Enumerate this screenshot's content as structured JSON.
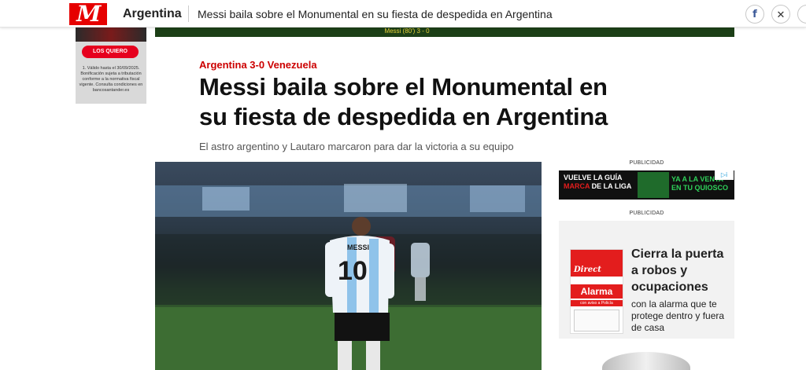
{
  "header": {
    "logo_letter": "M",
    "section": "Argentina",
    "title": "Messi baila sobre el Monumental en su fiesta de despedida en Argentina",
    "share": {
      "facebook_icon": "facebook-icon",
      "x_icon": "x-icon",
      "facebook_glyph": "f",
      "x_glyph": "✕"
    },
    "brand_color": "#e60000"
  },
  "left_ad": {
    "button_label": "LOS QUIERO",
    "legal_text": "1. Válido hasta el 30/09/2025. Bonificación sujeta a tributación conforme a la normativa fiscal vigente. Consulta condiciones en bancosantander.es"
  },
  "score_strip": {
    "text": "Messi (80') 3 - 0"
  },
  "article": {
    "kicker": "Argentina 3-0 Venezuela",
    "headline": "Messi baila sobre el Monumental en su fiesta de despedida en Argentina",
    "subtitle": "El astro argentino y Lautaro marcaron para dar la victoria a su equipo",
    "photo": {
      "jersey_number": "10",
      "jersey_name": "MESSI"
    }
  },
  "ads": {
    "publicidad_label_1": "PUBLICIDAD",
    "publicidad_label_2": "PUBLICIDAD",
    "banner_left_line1": "VUELVE LA GUÍA",
    "banner_left_line2a": "MARCA",
    "banner_left_line2b": " DE LA LIGA",
    "banner_right_line1": "YA A LA VENTA",
    "banner_right_line2": "EN TU QUIOSCO",
    "adchoices_glyph": "▷ⅰ",
    "alarm_brand": "Direct",
    "alarm_word": "Alarma",
    "alarm_sub": "con aviso a Policía",
    "alarm_headline": "Cierra la puerta a robos y ocupaciones",
    "alarm_body": "con la alarma que te protege dentro y fuera de casa"
  }
}
